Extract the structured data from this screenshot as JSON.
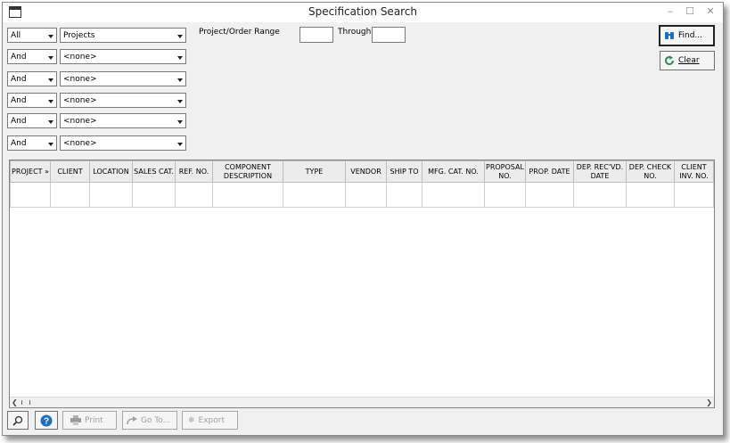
{
  "window": {
    "title": "Specification Search"
  },
  "titlebar": {
    "minimize": "–",
    "maximize": "☐",
    "close": "✕"
  },
  "criteria": [
    {
      "op": "All",
      "field": "Projects"
    },
    {
      "op": "And",
      "field": "<none>"
    },
    {
      "op": "And",
      "field": "<none>"
    },
    {
      "op": "And",
      "field": "<none>"
    },
    {
      "op": "And",
      "field": "<none>"
    },
    {
      "op": "And",
      "field": "<none>"
    }
  ],
  "range": {
    "label": "Project/Order Range",
    "through_label": "Through",
    "from": "",
    "to": ""
  },
  "buttons": {
    "find": "Find...",
    "clear": "Clear"
  },
  "grid": {
    "columns": [
      "PROJECT »",
      "CLIENT",
      "LOCATION",
      "SALES CAT.",
      "REF. NO.",
      "COMPONENT DESCRIPTION",
      "TYPE",
      "VENDOR",
      "SHIP TO",
      "MFG. CAT. NO.",
      "PROPOSAL NO.",
      "PROP. DATE",
      "DEP. REC'VD. DATE",
      "DEP. CHECK NO.",
      "CLIENT INV. NO."
    ]
  },
  "footer": {
    "print": "Print",
    "goto": "Go To...",
    "export": "Export"
  },
  "colors": {
    "accent": "#1f6fbf",
    "green": "#2e8b57",
    "border": "#7a7a7a"
  },
  "icons": [
    "window-icon",
    "binoculars-icon",
    "refresh-icon",
    "magnifier-icon",
    "help-icon",
    "printer-icon",
    "goto-arrow-icon",
    "export-icon"
  ]
}
